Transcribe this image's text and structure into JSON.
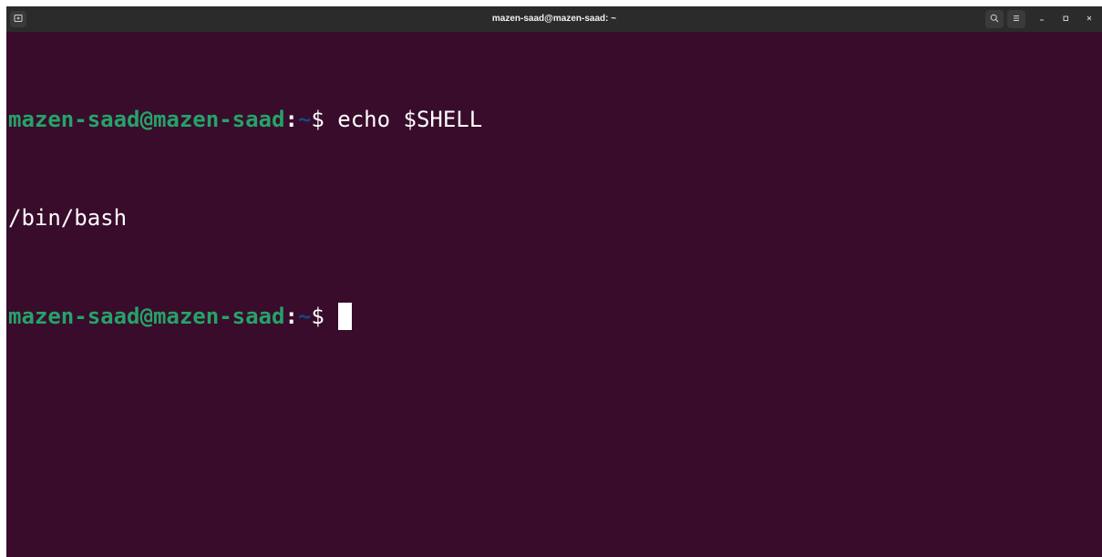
{
  "window": {
    "title": "mazen-saad@mazen-saad: ~"
  },
  "titlebar_icons": {
    "new_tab": "new-tab-icon",
    "search": "search-icon",
    "menu": "hamburger-menu-icon",
    "minimize": "minimize-icon",
    "maximize": "maximize-icon",
    "close": "close-icon"
  },
  "terminal": {
    "lines": [
      {
        "user_host": "mazen-saad@mazen-saad",
        "colon": ":",
        "path": "~",
        "prompt": "$",
        "command": " echo $SHELL"
      },
      {
        "output": "/bin/bash"
      },
      {
        "user_host": "mazen-saad@mazen-saad",
        "colon": ":",
        "path": "~",
        "prompt": "$",
        "command": ""
      }
    ]
  },
  "colors": {
    "background": "#380c2a",
    "user_host": "#26a269",
    "path": "#12488b",
    "text": "#ffffff",
    "titlebar": "#2b2b2b"
  }
}
